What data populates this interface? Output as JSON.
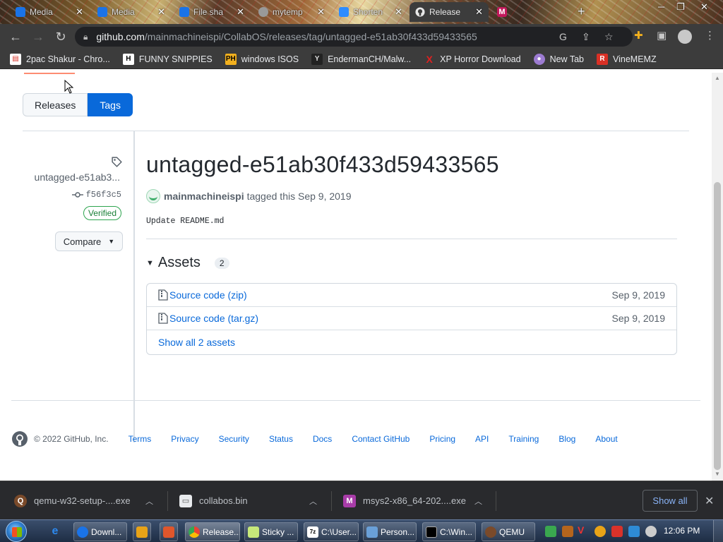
{
  "browser": {
    "tabs": [
      {
        "title": "Media",
        "active": false
      },
      {
        "title": "Media",
        "active": false
      },
      {
        "title": "File sha",
        "active": false
      },
      {
        "title": "mytemp",
        "active": false
      },
      {
        "title": "Shorten",
        "active": false
      },
      {
        "title": "Release",
        "active": true
      }
    ],
    "url_host": "github.com",
    "url_path": "/mainmachineispi/CollabOS/releases/tag/untagged-e51ab30f433d59433565",
    "bookmarks": [
      {
        "label": "2pac Shakur - Chro...",
        "icon": "H",
        "color": "#d93025"
      },
      {
        "label": "FUNNY SNIPPIES",
        "icon": "H",
        "color": "#ffffff"
      },
      {
        "label": "windows ISOS",
        "icon": "PH",
        "color": "#f2b01e"
      },
      {
        "label": "EndermanCH/Malw...",
        "icon": "Y",
        "color": "#444444"
      },
      {
        "label": "XP Horror Download",
        "icon": "X",
        "color": "#e02020"
      },
      {
        "label": "New Tab",
        "icon": "●",
        "color": "#9c7bd1"
      },
      {
        "label": "VineMEMZ",
        "icon": "R",
        "color": "#d93025"
      }
    ]
  },
  "page": {
    "segmented": {
      "releases": "Releases",
      "tags": "Tags"
    },
    "sidebar": {
      "tag_short": "untagged-e51ab3...",
      "commit": "f56f3c5",
      "verified": "Verified",
      "compare": "Compare"
    },
    "release": {
      "title": "untagged-e51ab30f433d59433565",
      "author": "mainmachineispi",
      "tagged_text": "tagged this Sep 9, 2019",
      "commit_message": "Update README.md"
    },
    "assets": {
      "title": "Assets",
      "count": "2",
      "items": [
        {
          "name": "Source code",
          "ext": "(zip)",
          "date": "Sep 9, 2019"
        },
        {
          "name": "Source code",
          "ext": "(tar.gz)",
          "date": "Sep 9, 2019"
        }
      ],
      "show_all": "Show all 2 assets"
    },
    "footer": {
      "copyright": "© 2022 GitHub, Inc.",
      "links": [
        "Terms",
        "Privacy",
        "Security",
        "Status",
        "Docs",
        "Contact GitHub",
        "Pricing",
        "API",
        "Training",
        "Blog",
        "About"
      ]
    }
  },
  "downloads": {
    "items": [
      {
        "name": "qemu-w32-setup-....exe"
      },
      {
        "name": "collabos.bin"
      },
      {
        "name": "msys2-x86_64-202....exe"
      }
    ],
    "show_all": "Show all"
  },
  "taskbar": {
    "tasks": [
      "Downl...",
      "Release...",
      "Sticky ...",
      "C:\\User...",
      "Person...",
      "C:\\Win...",
      "QEMU"
    ],
    "clock": "12:06 PM"
  }
}
